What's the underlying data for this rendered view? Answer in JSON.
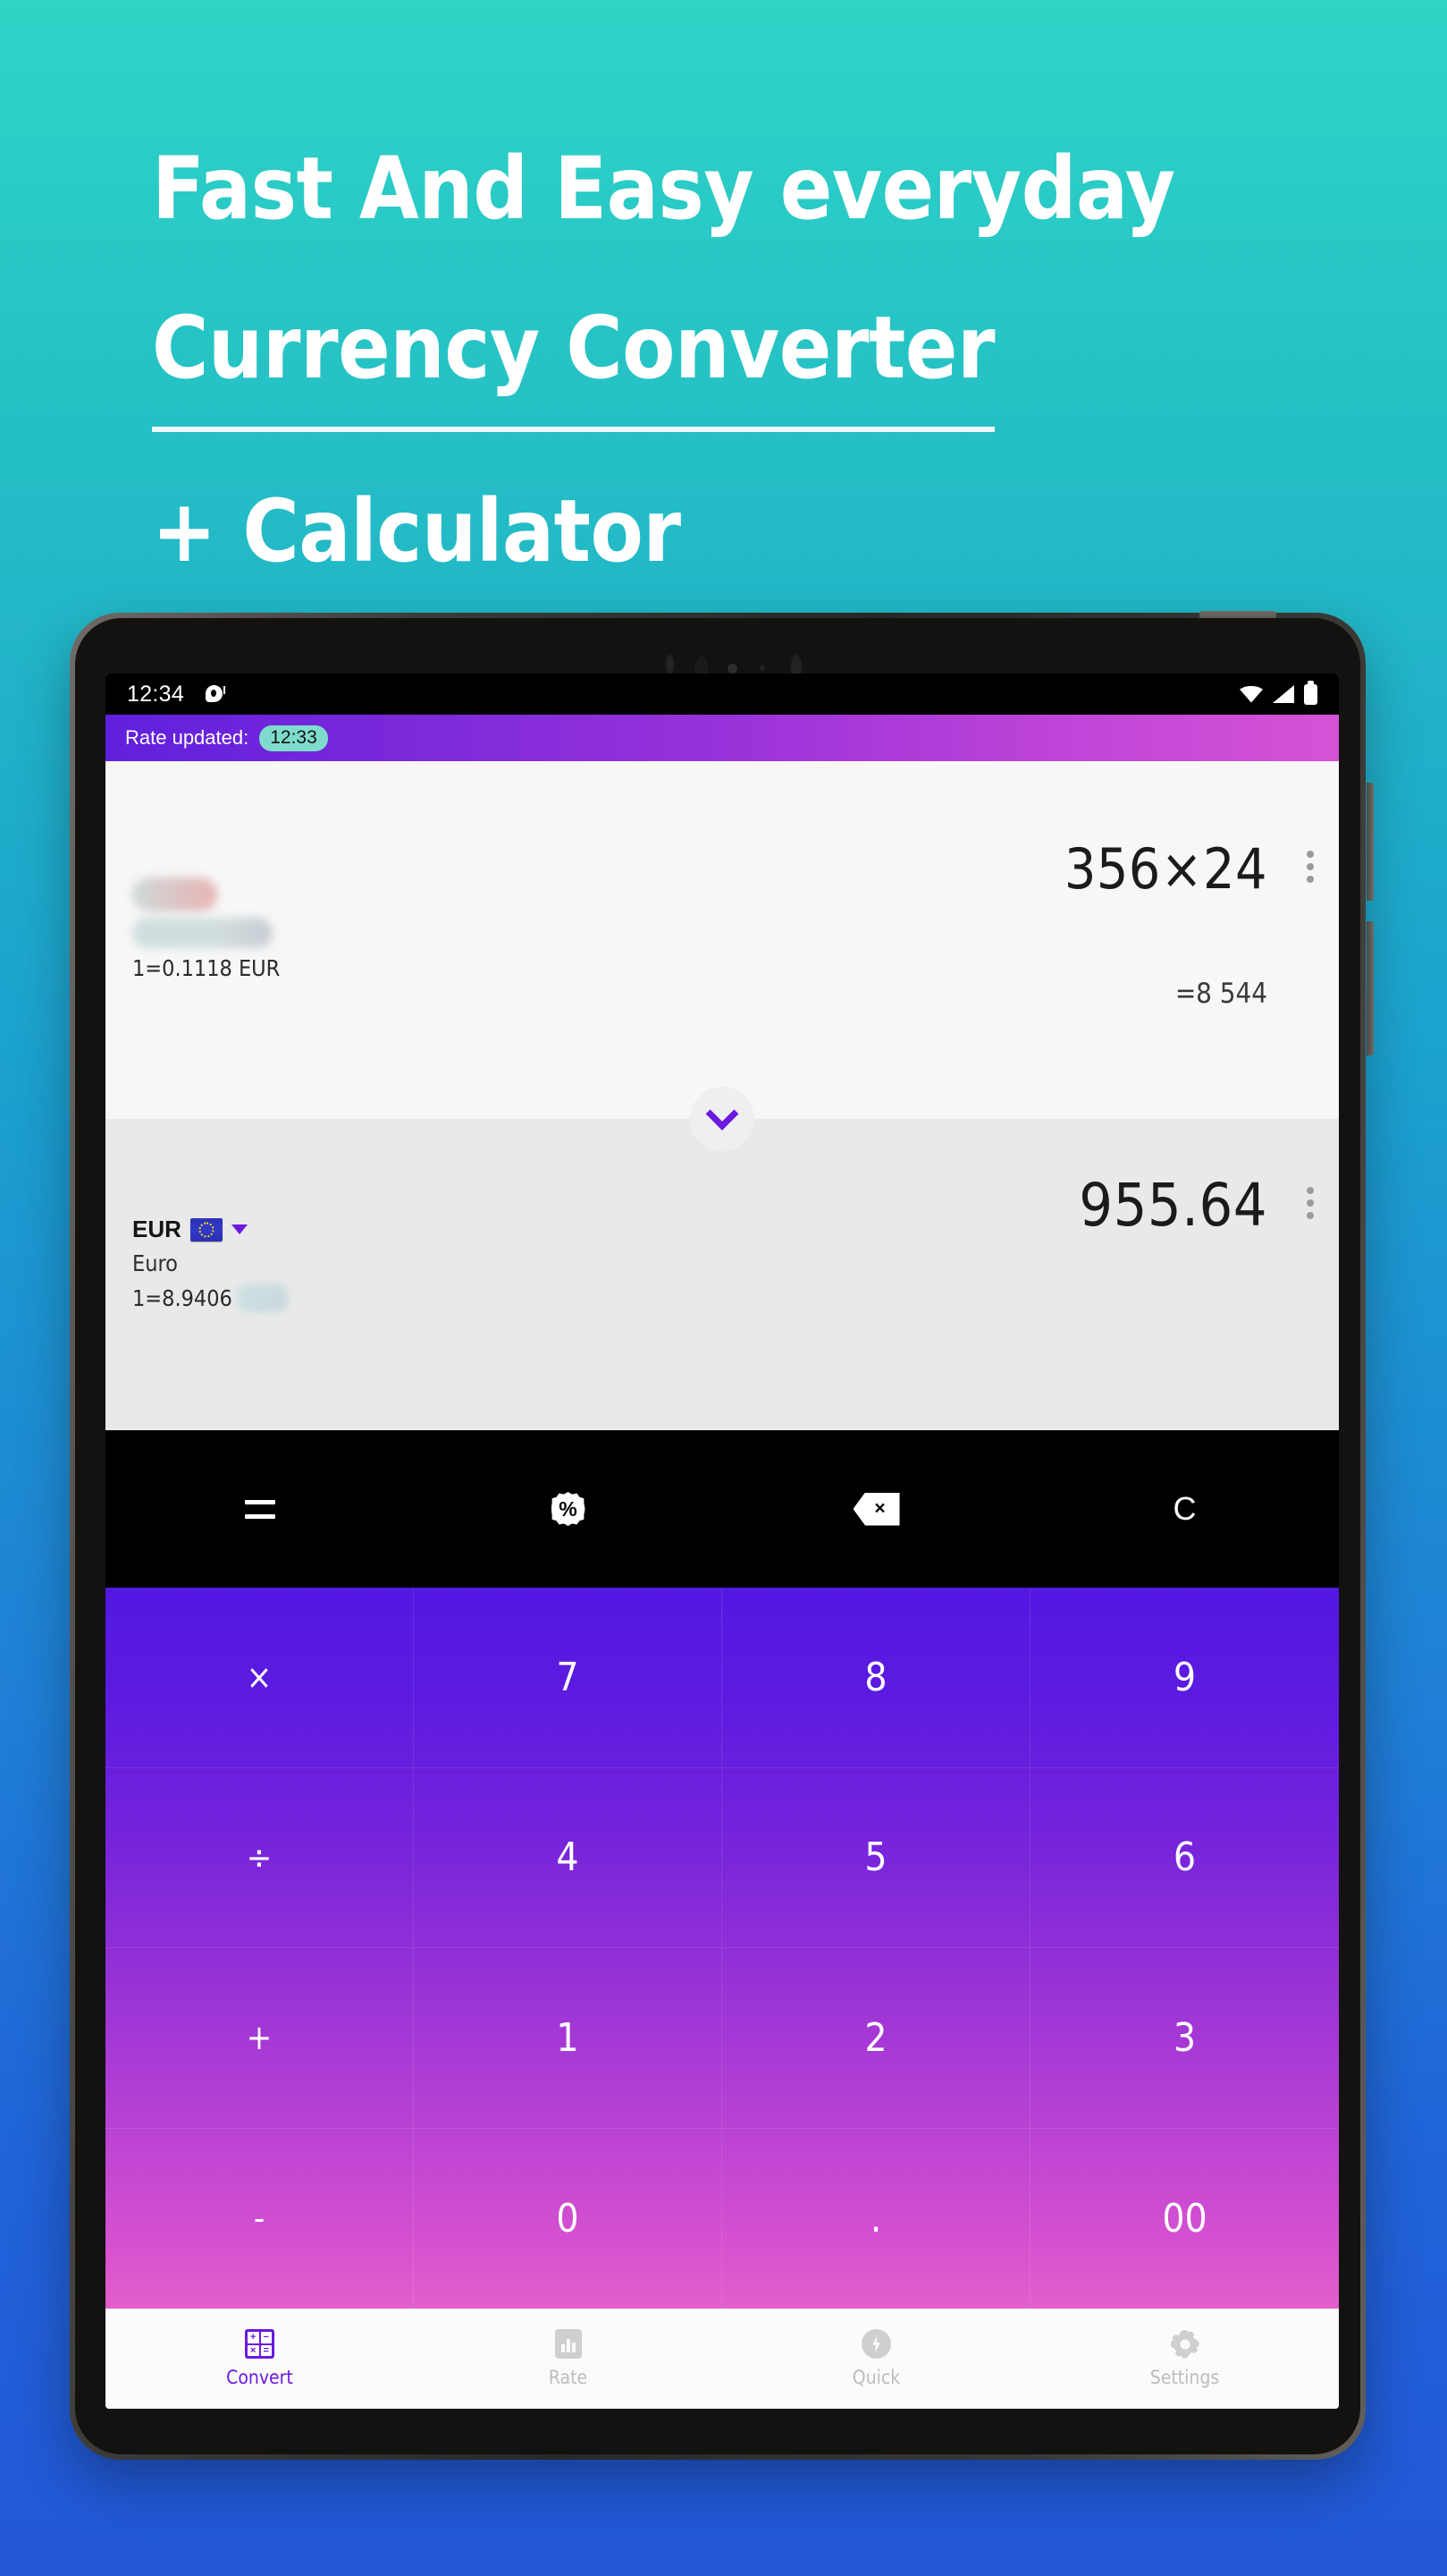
{
  "promo": {
    "line1": "Fast And Easy everyday",
    "line2": "Currency Converter",
    "line3": "+ Calculator"
  },
  "colors": {
    "background_top": "#2fd4c6",
    "background_bottom": "#2257d6",
    "appbar_start": "#6020dd",
    "appbar_end": "#d653d6",
    "accent_purple": "#6a1ae0",
    "badge_teal": "#7fdccd",
    "keypad_start": "#5318e2",
    "keypad_end": "#e25fcb"
  },
  "statusbar": {
    "time": "12:34",
    "icons": [
      "notification-icon",
      "wifi-icon",
      "signal-icon",
      "battery-icon"
    ]
  },
  "appbar": {
    "label": "Rate updated:",
    "badge_time": "12:33"
  },
  "converter": {
    "from": {
      "amount": "356×24",
      "result": "=8 544",
      "rate": "1=0.1118 EUR",
      "currency_code": "",
      "currency_name": "",
      "redacted": true
    },
    "to": {
      "amount": "955.64",
      "currency_code": "EUR",
      "currency_name": "Euro",
      "rate_prefix": "1=8.9406",
      "flag": "eu-flag-icon",
      "redacted_suffix": true
    },
    "swap_icon": "chevron-down-icon"
  },
  "function_row": [
    {
      "name": "equals-button",
      "label": "=",
      "icon": "equals-icon"
    },
    {
      "name": "percent-button",
      "label": "%",
      "icon": "percent-icon"
    },
    {
      "name": "backspace-button",
      "label": "×",
      "icon": "backspace-icon"
    },
    {
      "name": "clear-button",
      "label": "C",
      "icon": "clear-icon"
    }
  ],
  "keypad": [
    {
      "label": "×",
      "type": "op"
    },
    {
      "label": "7",
      "type": "digit"
    },
    {
      "label": "8",
      "type": "digit"
    },
    {
      "label": "9",
      "type": "digit"
    },
    {
      "label": "÷",
      "type": "op"
    },
    {
      "label": "4",
      "type": "digit"
    },
    {
      "label": "5",
      "type": "digit"
    },
    {
      "label": "6",
      "type": "digit"
    },
    {
      "label": "+",
      "type": "op"
    },
    {
      "label": "1",
      "type": "digit"
    },
    {
      "label": "2",
      "type": "digit"
    },
    {
      "label": "3",
      "type": "digit"
    },
    {
      "label": "-",
      "type": "op"
    },
    {
      "label": "0",
      "type": "digit"
    },
    {
      "label": ".",
      "type": "digit"
    },
    {
      "label": "00",
      "type": "digit"
    }
  ],
  "bottom_nav": [
    {
      "label": "Convert",
      "icon": "calculator-icon",
      "active": true
    },
    {
      "label": "Rate",
      "icon": "chart-icon",
      "active": false
    },
    {
      "label": "Quick",
      "icon": "bolt-icon",
      "active": false
    },
    {
      "label": "Settings",
      "icon": "gear-icon",
      "active": false
    }
  ]
}
